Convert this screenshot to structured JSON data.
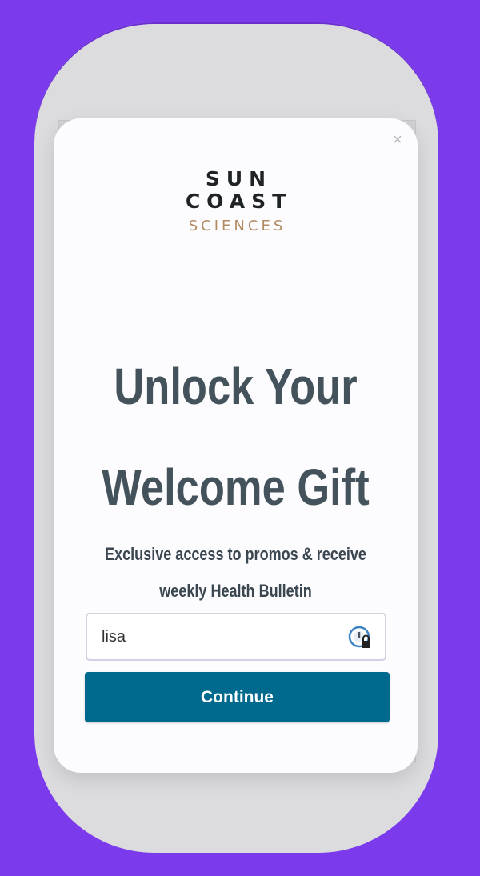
{
  "modal": {
    "close_symbol": "×",
    "logo": {
      "line1": "SUN",
      "line2": "COAST",
      "line3": "SCIENCES"
    },
    "headline": {
      "line1": "Unlock Your",
      "line2": "Welcome Gift"
    },
    "subtext": {
      "line1": "Exclusive access to promos & receive",
      "line2": "weekly Health Bulletin"
    },
    "email": {
      "value": "lisa",
      "icon": "password-manager-icon"
    },
    "continue_label": "Continue"
  },
  "colors": {
    "background": "#7c3aed",
    "button": "#006a8e",
    "headline": "#44535b",
    "logo_accent": "#b28b63"
  }
}
